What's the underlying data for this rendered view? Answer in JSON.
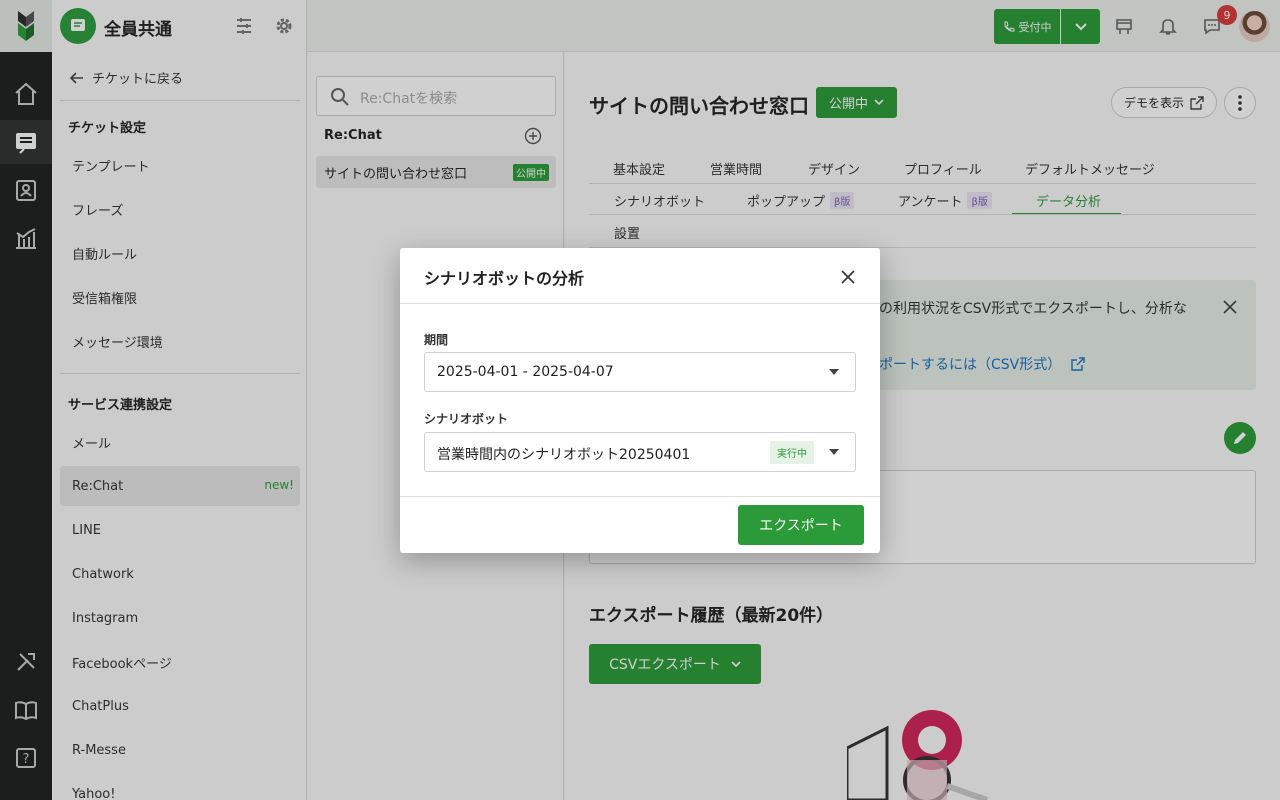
{
  "header": {
    "workspace_name": "全員共通",
    "call_status": "受付中",
    "notification_count": "9"
  },
  "sidebar": {
    "back_label": "チケットに戻る",
    "section1_title": "チケット設定",
    "section1_items": [
      "テンプレート",
      "フレーズ",
      "自動ルール",
      "受信箱権限",
      "メッセージ環境"
    ],
    "section2_title": "サービス連携設定",
    "section2_items": [
      "メール",
      "Re:Chat",
      "LINE",
      "Chatwork",
      "Instagram",
      "Facebookページ",
      "ChatPlus",
      "R-Messe",
      "Yahoo!"
    ],
    "new_tag": "new!"
  },
  "list": {
    "search_placeholder": "Re:Chatを検索",
    "title": "Re:Chat",
    "item_label": "サイトの問い合わせ窓口",
    "item_status": "公開中"
  },
  "main": {
    "title": "サイトの問い合わせ窓口",
    "status_label": "公開中",
    "demo_label": "デモを表示",
    "tabs_row1": [
      "基本設定",
      "営業時間",
      "デザイン",
      "プロフィール",
      "デフォルトメッセージ"
    ],
    "tabs_row2": [
      "シナリオボット",
      "ポップアップ",
      "アンケート",
      "データ分析"
    ],
    "tabs_row3": [
      "設置"
    ],
    "beta_label": "β版",
    "info_text": "の利用状況をCSV形式でエクスポートし、分析な",
    "info_link": "ポートするには（CSV形式）",
    "history_title": "エクスポート履歴（最新20件）",
    "csv_button": "CSVエクスポート"
  },
  "modal": {
    "title": "シナリオボットの分析",
    "period_label": "期間",
    "period_value": "2025-04-01 - 2025-04-07",
    "bot_label": "シナリオボット",
    "bot_value": "営業時間内のシナリオボット20250401",
    "bot_status": "実行中",
    "export_label": "エクスポート"
  },
  "colors": {
    "brand_green": "#2a9b38",
    "rail_dark": "#1f2020",
    "link_blue": "#1b74c5"
  }
}
